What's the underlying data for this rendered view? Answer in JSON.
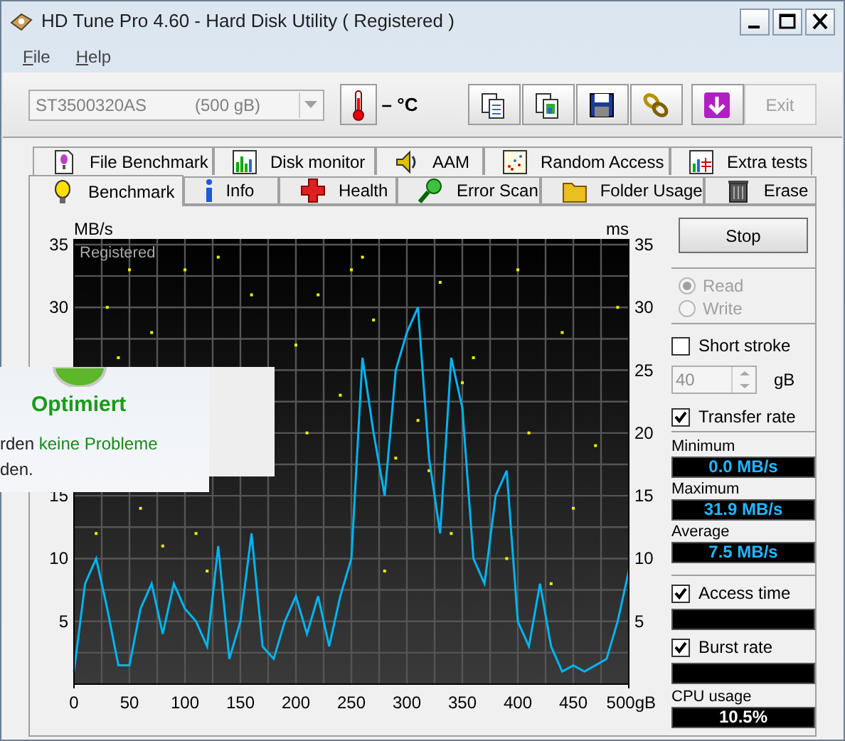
{
  "window": {
    "title": "HD Tune Pro 4.60 - Hard Disk Utility (  Registered )"
  },
  "menu": [
    {
      "label": "File"
    },
    {
      "label": "Help"
    }
  ],
  "toolbar": {
    "drive": "ST3500320AS",
    "capacity": "(500 gB)",
    "temperature": "– °C",
    "exit": {
      "label": "Exit",
      "disabled": true
    }
  },
  "tabs_back": [
    {
      "label": "File Benchmark",
      "kind": "file"
    },
    {
      "label": "Disk monitor",
      "kind": "monitor"
    },
    {
      "label": "AAM",
      "kind": "speaker"
    },
    {
      "label": "Random Access",
      "kind": "scatter"
    },
    {
      "label": "Extra tests",
      "kind": "grid"
    }
  ],
  "tabs_front": [
    {
      "label": "Benchmark",
      "kind": "bulb",
      "selected": true
    },
    {
      "label": "Info",
      "kind": "info",
      "selected": false
    },
    {
      "label": "Health",
      "kind": "cross",
      "selected": false
    },
    {
      "label": "Error Scan",
      "kind": "magnifier",
      "selected": false
    },
    {
      "label": "Folder Usage",
      "kind": "folder",
      "selected": false
    },
    {
      "label": "Erase",
      "kind": "bin",
      "selected": false
    }
  ],
  "chart": {
    "unit_left": "MB/s",
    "unit_right": "ms",
    "watermark": "Registered",
    "chart_data": {
      "type": "line",
      "x": [
        0,
        10,
        20,
        30,
        40,
        50,
        60,
        70,
        80,
        90,
        100,
        110,
        120,
        130,
        140,
        150,
        160,
        170,
        180,
        190,
        200,
        210,
        220,
        230,
        240,
        250,
        260,
        270,
        280,
        290,
        300,
        310,
        320,
        330,
        340,
        350,
        360,
        370,
        380,
        390,
        400,
        410,
        420,
        430,
        440,
        450,
        460,
        470,
        480,
        490,
        500
      ],
      "series": [
        {
          "type": "line",
          "color": "#00b4f0",
          "values": [
            1,
            8,
            10,
            6,
            1.5,
            1.5,
            6,
            8,
            4,
            8,
            6,
            5,
            3,
            11,
            2,
            5,
            12,
            3,
            2,
            5,
            7,
            4,
            7,
            3,
            7,
            10,
            26,
            20,
            15,
            25,
            28,
            30,
            18,
            12,
            26,
            22,
            10,
            8,
            15,
            17,
            5,
            3,
            8,
            3,
            1,
            1.5,
            1,
            1.5,
            2,
            5,
            9
          ]
        },
        {
          "type": "scatter",
          "color": "#f0f000",
          "values": [
            null,
            null,
            12,
            30,
            26,
            33,
            14,
            28,
            11,
            null,
            33,
            12,
            9,
            34,
            null,
            null,
            31,
            null,
            null,
            null,
            27,
            20,
            31,
            null,
            23,
            33,
            34,
            29,
            9,
            18,
            null,
            21,
            17,
            32,
            12,
            24,
            26,
            null,
            null,
            10,
            33,
            20,
            null,
            8,
            28,
            14,
            null,
            19,
            null,
            30,
            null
          ]
        }
      ],
      "grid": true,
      "xlim": [
        0,
        500
      ],
      "ylim": [
        0,
        35
      ],
      "xticks": [
        0,
        50,
        100,
        150,
        200,
        250,
        300,
        350,
        400,
        450,
        {
          "value": 500,
          "label": "500gB"
        }
      ],
      "yticks": [
        {
          "value": 5,
          "label": "5"
        },
        {
          "value": 10,
          "label": "10"
        },
        {
          "value": 15,
          "label": "15"
        },
        {
          "value": 30,
          "label": "30"
        },
        {
          "value": 35,
          "label": "35"
        }
      ]
    },
    "right_ticks": [
      "35",
      "30",
      "25",
      "20",
      "15",
      "10",
      "5"
    ]
  },
  "side": {
    "stop": "Stop",
    "modes": [
      {
        "label": "Read",
        "selected": true,
        "disabled": true
      },
      {
        "label": "Write",
        "selected": false,
        "disabled": true
      }
    ],
    "short_stroke": {
      "label": "Short stroke",
      "checked": false
    },
    "stroke_value": "40",
    "stroke_unit": "gB",
    "transfer_rate": {
      "label": "Transfer rate",
      "checked": true
    },
    "readings": [
      {
        "label": "Minimum",
        "value": "0.0 MB/s"
      },
      {
        "label": "Maximum",
        "value": "31.9 MB/s"
      },
      {
        "label": "Average",
        "value": "7.5 MB/s"
      }
    ],
    "access_time": {
      "label": "Access time",
      "checked": true
    },
    "burst_rate": {
      "label": "Burst rate",
      "checked": true
    },
    "cpu": {
      "label": "CPU usage",
      "value": "10.5%"
    }
  },
  "notification": {
    "title": "Optimiert",
    "lines": [
      [
        {
          "text": "rden "
        },
        {
          "text": "keine Probleme",
          "highlight": true
        }
      ],
      [
        {
          "text": "den."
        }
      ]
    ]
  }
}
